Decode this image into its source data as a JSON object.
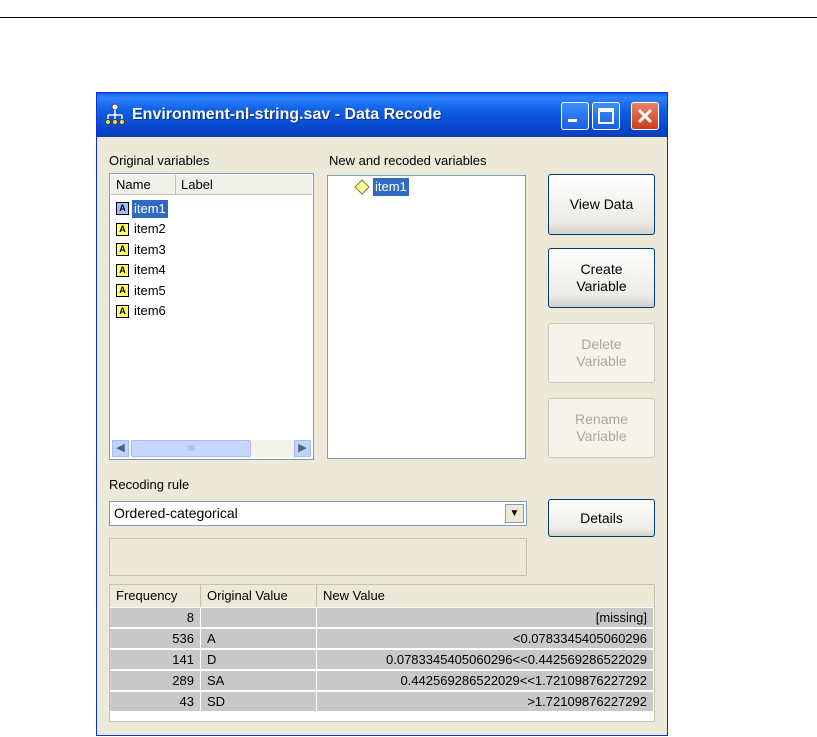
{
  "window": {
    "title": "Environment-nl-string.sav - Data Recode"
  },
  "original_variables": {
    "label": "Original variables",
    "columns": [
      "Name",
      "Label"
    ],
    "items": [
      "item1",
      "item2",
      "item3",
      "item4",
      "item5",
      "item6"
    ],
    "selected_index": 0,
    "scroll_thumb_grip": "III"
  },
  "new_variables": {
    "label": "New and recoded variables",
    "items": [
      "item1"
    ]
  },
  "buttons": {
    "view_data": "View Data",
    "create_variable": "Create\nVariable",
    "delete_variable": "Delete\nVariable",
    "rename_variable": "Rename\nVariable",
    "details": "Details"
  },
  "recoding": {
    "label": "Recoding rule",
    "selected": "Ordered-categorical"
  },
  "table": {
    "columns": [
      "Frequency",
      "Original Value",
      "New Value"
    ],
    "rows": [
      {
        "frequency": "8",
        "original": "",
        "new": "[missing]"
      },
      {
        "frequency": "536",
        "original": "A",
        "new": "<0.0783345405060296"
      },
      {
        "frequency": "141",
        "original": "D",
        "new": "0.0783345405060296<<0.442569286522029"
      },
      {
        "frequency": "289",
        "original": "SA",
        "new": "0.442569286522029<<1.72109876227292"
      },
      {
        "frequency": "43",
        "original": "SD",
        "new": ">1.72109876227292"
      }
    ]
  },
  "icons": {
    "app": "network-tree-icon",
    "var_type": "A",
    "new_var": "diamond-icon"
  }
}
